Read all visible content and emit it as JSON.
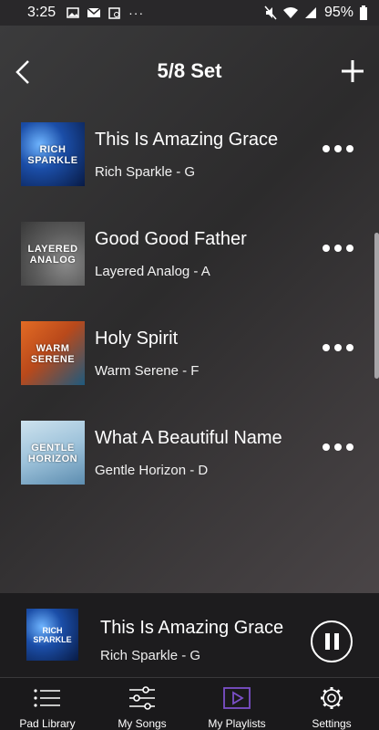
{
  "status_bar": {
    "time": "3:25",
    "battery": "95%"
  },
  "header": {
    "title": "5/8 Set"
  },
  "songs": [
    {
      "title": "This Is Amazing Grace",
      "subtitle": "Rich Sparkle - G",
      "art_label": "RICH\nSPARKLE",
      "art_colors": [
        "#0c2a6b",
        "#3a78d8"
      ]
    },
    {
      "title": "Good Good Father",
      "subtitle": "Layered Analog - A",
      "art_label": "LAYERED\nANALOG",
      "art_colors": [
        "#4a4a4a",
        "#7b7b7b"
      ]
    },
    {
      "title": "Holy Spirit",
      "subtitle": "Warm Serene - F",
      "art_label": "WARM\nSERENE",
      "art_colors": [
        "#c8501c",
        "#1c4f73"
      ]
    },
    {
      "title": "What A Beautiful Name",
      "subtitle": "Gentle Horizon - D",
      "art_label": "GENTLE\nHORIZON",
      "art_colors": [
        "#a8c9dc",
        "#5e8fb0"
      ]
    }
  ],
  "now_playing": {
    "title": "This Is Amazing Grace",
    "subtitle": "Rich Sparkle - G",
    "art_label": "RICH\nSPARKLE"
  },
  "tabs": [
    {
      "label": "Pad Library",
      "icon": "list-icon",
      "active": false
    },
    {
      "label": "My Songs",
      "icon": "sliders-icon",
      "active": false
    },
    {
      "label": "My Playlists",
      "icon": "play-box-icon",
      "active": true,
      "color": "#7b4fc9"
    },
    {
      "label": "Settings",
      "icon": "gear-icon",
      "active": false
    }
  ],
  "colors": {
    "accent_purple": "#7b4fc9"
  }
}
